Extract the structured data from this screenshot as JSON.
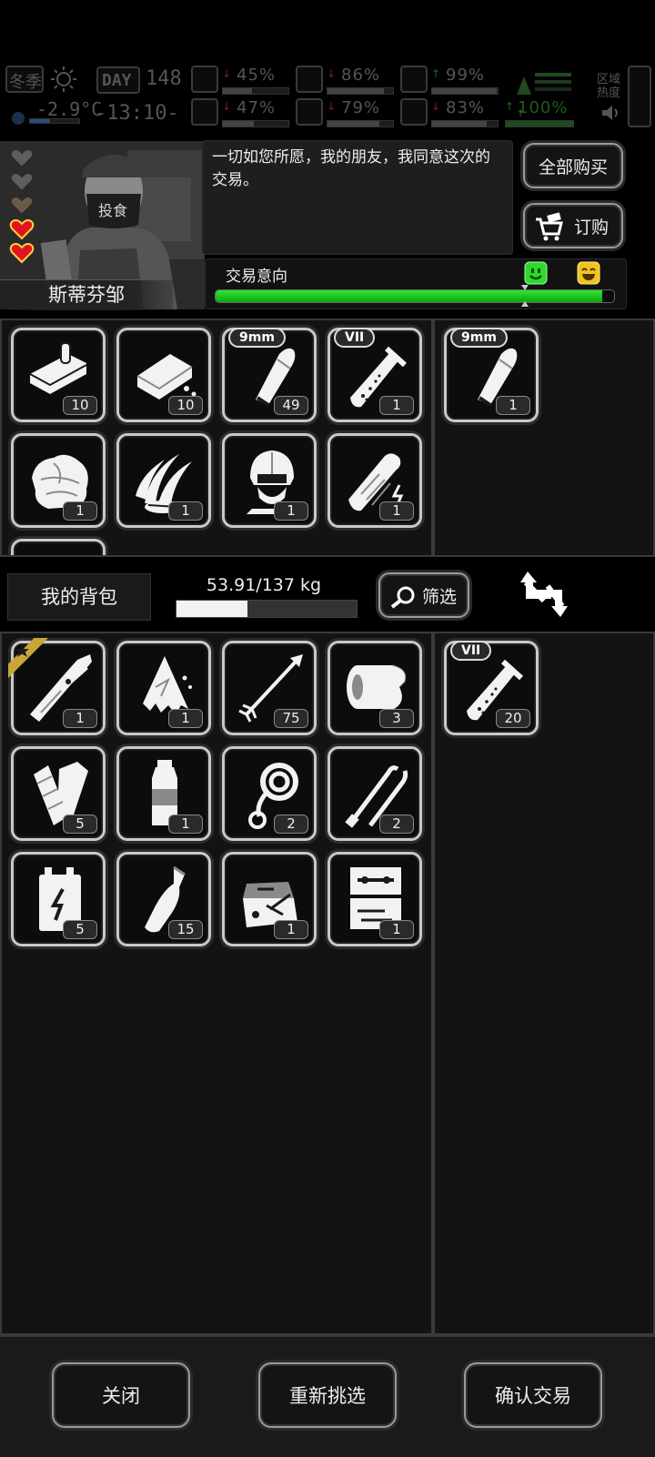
{
  "hud": {
    "season": "冬季",
    "day_label": "DAY",
    "day_number": "148",
    "temperature": "-2.9°C",
    "clock": "-13:10-",
    "stats": [
      {
        "icon": "medkit-icon",
        "value": "45%",
        "arrow": "down",
        "arrow_color": "#7a1f1f",
        "fill": 0.45
      },
      {
        "icon": "stomach-icon",
        "value": "86%",
        "arrow": "down",
        "arrow_color": "#7a1f1f",
        "fill": 0.86
      },
      {
        "icon": "armor-icon",
        "value": "99%",
        "arrow": "up",
        "arrow_color": "#1f6a1f",
        "fill": 0.99
      },
      {
        "icon": "brain-icon",
        "value": "47%",
        "arrow": "down",
        "arrow_color": "#7a1f1f",
        "fill": 0.47
      },
      {
        "icon": "water-drop-icon",
        "value": "79%",
        "arrow": "down",
        "arrow_color": "#7a1f1f",
        "fill": 0.79
      },
      {
        "icon": "heart-icon",
        "value": "83%",
        "arrow": "down",
        "arrow_color": "#7a1f1f",
        "fill": 0.83
      },
      {
        "icon": "energy-icon",
        "value": "100%",
        "arrow": "up",
        "arrow_color": "#1f6a1f",
        "fill": 1.0
      }
    ],
    "zone_label_1": "区域",
    "zone_label_2": "热度"
  },
  "npc": {
    "name": "斯蒂芬邹",
    "hearts_total": 5,
    "hearts_filled": 2,
    "dialog": "一切如您所愿，我的朋友，我同意这次的交易。",
    "mask_text": "投食"
  },
  "buttons": {
    "buy_all": "全部购买",
    "order": "订购",
    "filter": "筛选",
    "close": "关闭",
    "reselect": "重新挑选",
    "confirm": "确认交易"
  },
  "trade_intent": {
    "label": "交易意向",
    "level": 0.97,
    "colors": {
      "bar": "#22c322",
      "good": "#2fd82f",
      "great": "#f2c31c"
    }
  },
  "merchant_inventory": [
    {
      "icon": "canned-food-icon",
      "qty": "10"
    },
    {
      "icon": "soap-bar-icon",
      "qty": "10"
    },
    {
      "icon": "bullet-icon",
      "qty": "49",
      "tag": "9mm"
    },
    {
      "icon": "test-tube-icon",
      "qty": "1",
      "tag": "VII"
    },
    {
      "icon": "cloth-icon",
      "qty": "1"
    },
    {
      "icon": "claw-blades-icon",
      "qty": "1"
    },
    {
      "icon": "helmet-icon",
      "qty": "1"
    },
    {
      "icon": "stun-baton-icon",
      "qty": "1"
    }
  ],
  "merchant_offer": [
    {
      "icon": "bullet-icon",
      "qty": "1",
      "tag": "9mm"
    }
  ],
  "backpack": {
    "label": "我的背包",
    "weight": "53.91/137 kg",
    "weight_fill": 0.3935
  },
  "player_inventory": [
    {
      "icon": "multitool-icon",
      "qty": "1",
      "starred": true
    },
    {
      "icon": "torn-cloth-icon",
      "qty": "1"
    },
    {
      "icon": "arrow-icon",
      "qty": "75"
    },
    {
      "icon": "bandage-roll-icon",
      "qty": "3"
    },
    {
      "icon": "cloth-strips-icon",
      "qty": "5"
    },
    {
      "icon": "water-bottle-icon",
      "qty": "1"
    },
    {
      "icon": "rope-icon",
      "qty": "2"
    },
    {
      "icon": "lockpick-icon",
      "qty": "2"
    },
    {
      "icon": "battery-icon",
      "qty": "5"
    },
    {
      "icon": "empty-bottle-icon",
      "qty": "15"
    },
    {
      "icon": "repair-kit-icon",
      "qty": "1"
    },
    {
      "icon": "toolbox-icon",
      "qty": "1"
    }
  ],
  "player_offer": [
    {
      "icon": "test-tube-icon",
      "qty": "20",
      "tag": "VII"
    }
  ]
}
